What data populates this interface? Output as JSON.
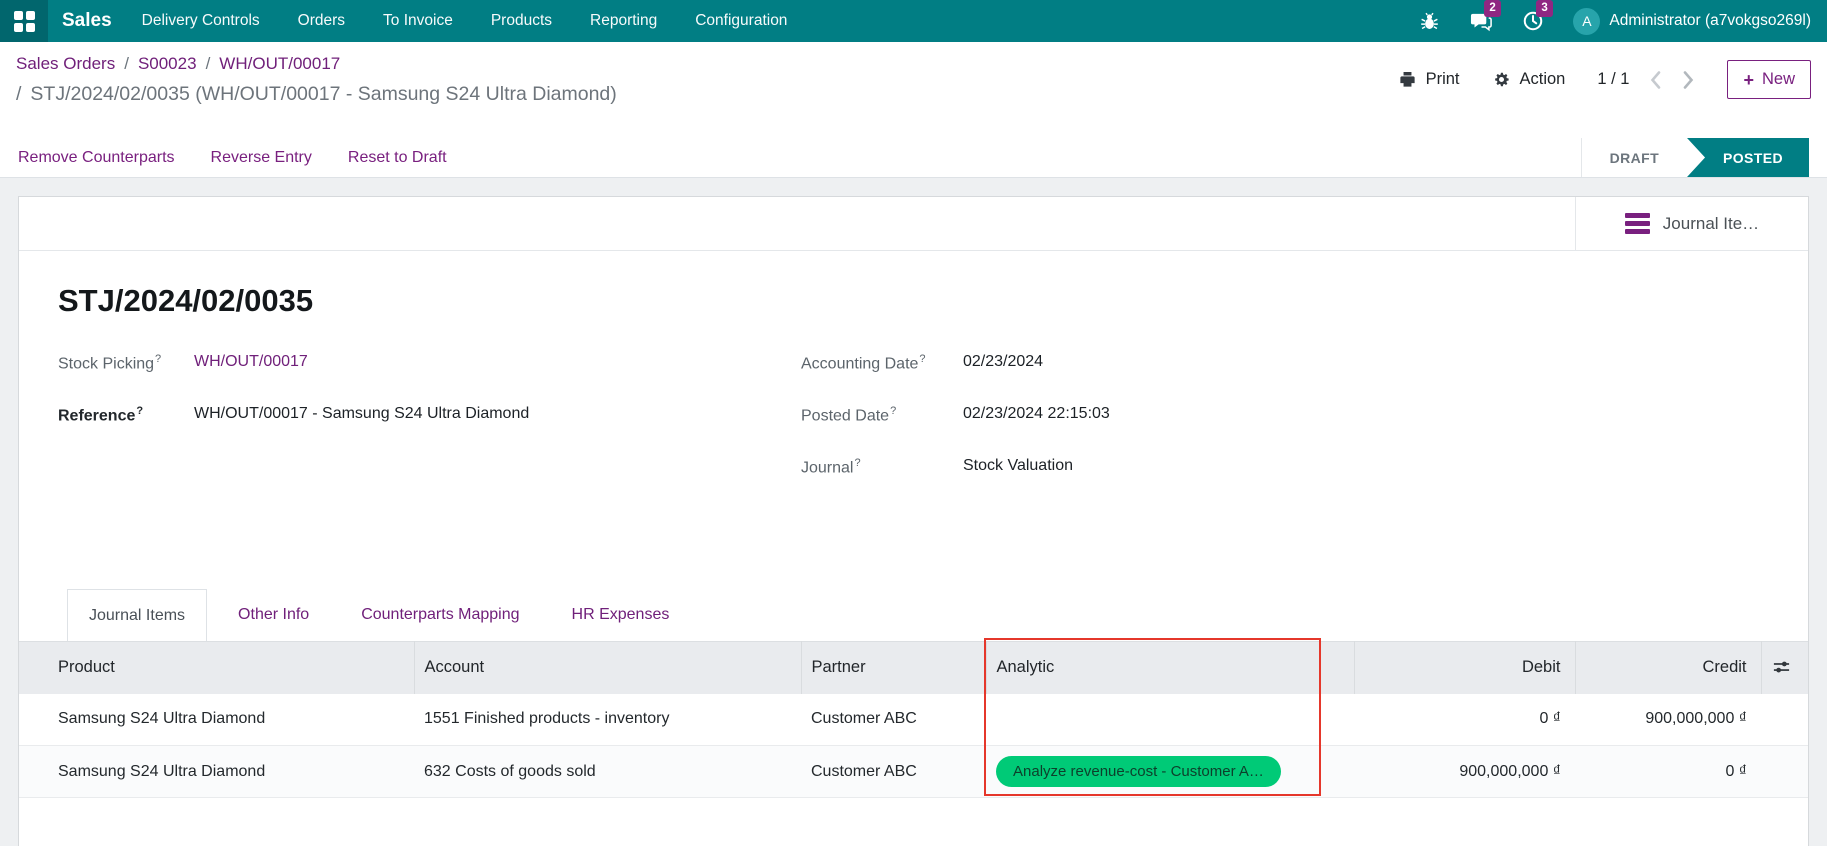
{
  "colors": {
    "nav": "#017e84",
    "nav-dark": "#01666d",
    "avatar": "#27a4ab",
    "badge": "#8f2782",
    "link": "#70207a",
    "accent": "#79207f",
    "posted": "#017e84",
    "tag-green": "#00ca77",
    "tag-green-text": "#0d3f2b",
    "annotation-red": "#e5372b",
    "header-bg": "#e9ebee",
    "border": "#dee2e6"
  },
  "nav": {
    "app": "Sales",
    "menus": [
      "Delivery Controls",
      "Orders",
      "To Invoice",
      "Products",
      "Reporting",
      "Configuration"
    ],
    "chat_badge": "2",
    "activity_badge": "3",
    "user_initial": "A",
    "user": "Administrator (a7vokgso269l)"
  },
  "breadcrumb": {
    "separator": "/",
    "links": [
      "Sales Orders",
      "S00023",
      "WH/OUT/00017"
    ],
    "current": "STJ/2024/02/0035 (WH/OUT/00017 - Samsung S24 Ultra Diamond)"
  },
  "controls": {
    "print": "Print",
    "action": "Action",
    "pager": "1 / 1",
    "plus": "+",
    "new": "New"
  },
  "actions": [
    "Remove Counterparts",
    "Reverse Entry",
    "Reset to Draft"
  ],
  "statusbar": {
    "draft": "DRAFT",
    "posted": "POSTED"
  },
  "sheet": {
    "stat_button": "Journal Ite…"
  },
  "record": {
    "title": "STJ/2024/02/0035",
    "help_marker": "?",
    "fields": {
      "stock_picking": {
        "label": "Stock Picking",
        "value": "WH/OUT/00017"
      },
      "reference": {
        "label": "Reference",
        "value": "WH/OUT/00017 - Samsung S24 Ultra Diamond"
      },
      "accounting_date": {
        "label": "Accounting Date",
        "value": "02/23/2024"
      },
      "posted_date": {
        "label": "Posted Date",
        "value": "02/23/2024 22:15:03"
      },
      "journal": {
        "label": "Journal",
        "value": "Stock Valuation"
      }
    }
  },
  "tabs": [
    "Journal Items",
    "Other Info",
    "Counterparts Mapping",
    "HR Expenses"
  ],
  "table": {
    "headers": {
      "product": "Product",
      "account": "Account",
      "partner": "Partner",
      "analytic": "Analytic",
      "debit": "Debit",
      "credit": "Credit"
    },
    "rows": [
      {
        "product": "Samsung S24 Ultra Diamond",
        "account": "1551 Finished products - inventory",
        "partner": "Customer ABC",
        "analytic": "",
        "debit": "0 ₫",
        "credit": "900,000,000 ₫"
      },
      {
        "product": "Samsung S24 Ultra Diamond",
        "account": "632 Costs of goods sold",
        "partner": "Customer ABC",
        "analytic": "Analyze revenue-cost - Customer A…",
        "debit": "900,000,000 ₫",
        "credit": "0 ₫"
      }
    ]
  },
  "annotation": {
    "note": "red highlight box over Analytic column",
    "color": "#e5372b"
  }
}
